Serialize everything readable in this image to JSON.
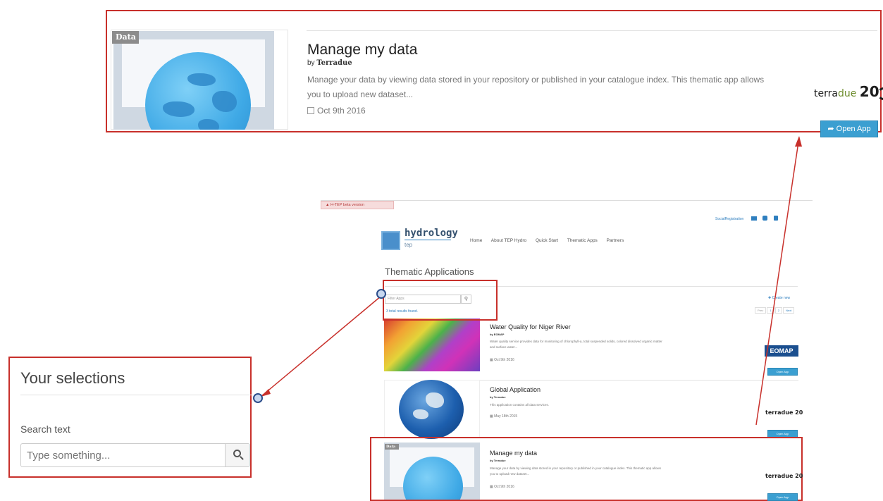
{
  "callout_top": {
    "tag": "Data",
    "title": "Manage my data",
    "by_prefix": "by",
    "author": "Terradue",
    "description_line1": "Manage your data by viewing data stored in your repository or published in your catalogue index. This thematic app allows",
    "description_line2": "you to upload new dataset...",
    "date": "Oct 9th 2016",
    "logo_text_a": "terra",
    "logo_text_b": "due",
    "logo_number": "20",
    "open_button": "Open App"
  },
  "callout_left": {
    "heading": "Your selections",
    "search_label": "Search text",
    "search_placeholder": "Type something..."
  },
  "mini": {
    "beta_banner": "H-TEP beta version",
    "signin_text": "SocialRegistration",
    "logo_title": "hydrology",
    "logo_sub": "tep",
    "nav": [
      "Home",
      "About TEP Hydro",
      "Quick Start",
      "Thematic Apps",
      "Partners"
    ],
    "page_title": "Thematic Applications",
    "filter_placeholder": "Filter Apps",
    "results_text": "3 total results found.",
    "create_new": "Create new",
    "pager": [
      "Prev",
      "1",
      "2",
      "Next"
    ],
    "apps": [
      {
        "title": "Water Quality for Niger River",
        "author": "by EOMAP",
        "desc1": "Water quality service provides data for monitoring of chlorophyll-a, total suspended solids, colored dissolved organic matter",
        "desc2": "and surface water...",
        "date": "Oct 9th 2016",
        "logo": "EOMAP",
        "button": "Open App"
      },
      {
        "title": "Global Application",
        "author": "by Terradue",
        "desc1": "This application contains all data services.",
        "desc2": "",
        "date": "May 18th 2015",
        "logo": "terradue 20",
        "button": "Open App"
      },
      {
        "tag": "Data",
        "title": "Manage my data",
        "author": "by Terradue",
        "desc1": "Manage your data by viewing data stored in your repository or published in your catalogue index. This thematic app allows",
        "desc2": "you to upload new dataset...",
        "date": "Oct 9th 2016",
        "logo": "terradue 20",
        "button": "Open App"
      }
    ]
  },
  "colors": {
    "annotation_red": "#c8302b",
    "button_blue": "#3b9fd1",
    "logo_green": "#6e8d2d"
  }
}
